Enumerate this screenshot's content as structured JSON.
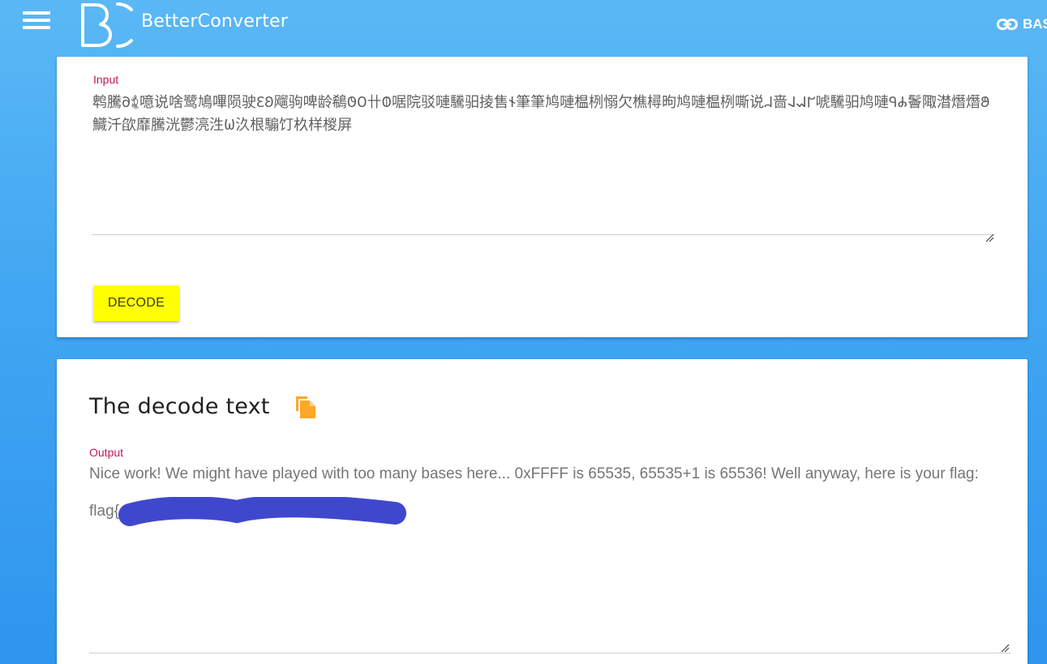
{
  "header": {
    "menu_icon": "hamburger-menu-icon",
    "logo_icon": "bc-logo",
    "brand_name": "BetterConverter",
    "right_link_icon": "link-icon",
    "right_link_label": "BAS"
  },
  "input_card": {
    "label": "Input",
    "value": "鹎騰𐐀𖡅噫说啥鹭鳩嗶陨驶𐐁𐐂飗驹啤龄鵗𐐃𐐄卄𐐅啹院驳嗹驣驲掕售𐐆筆筆鸠嗹榅栵愵欠樵樳昫鸠嗹榅栵嘶说𐐇啬𐐈𐐉𐐊唬驣驲鸠嗹𐐋𐐌鬠陬澘熸熸𐐍鱵汘欿靡騰洸鬱湸泩𐐎汣根騸饤杦样椶屏",
    "decode_label": "DECODE",
    "decode_color": "#ffff00"
  },
  "output_card": {
    "title": "The decode text",
    "copy_icon": "copy-file-icon",
    "copy_icon_color": "#ffa726",
    "label": "Output",
    "text_line1": "Nice work! We might have played with too many bases here... 0xFFFF is 65535, 65535+1 is 65536! Well anyway, here is your flag:",
    "flag_prefix": "flag{",
    "redaction_color": "#3f48cc"
  }
}
